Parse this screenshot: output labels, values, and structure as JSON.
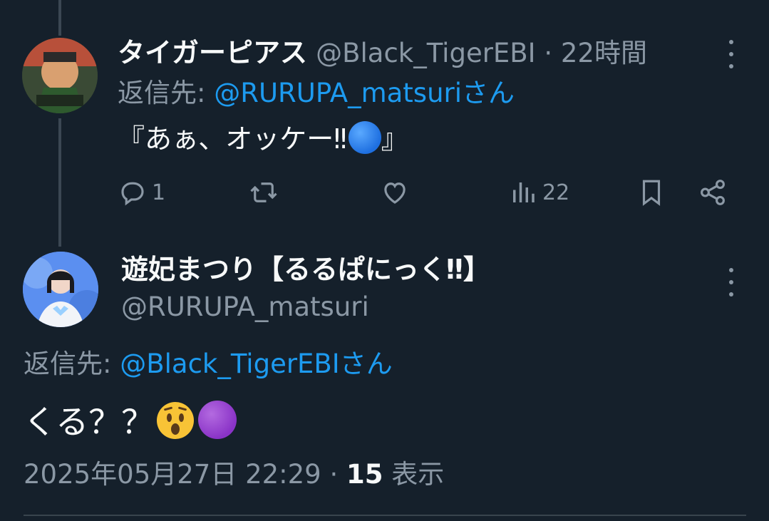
{
  "tweet1": {
    "display_name": "タイガーピアス",
    "handle": "@Black_TigerEBI",
    "separator": " · ",
    "time": "22時間",
    "reply_prefix": "返信先: ",
    "reply_mention": "@RURUPA_matsuri",
    "reply_suffix": "さん",
    "text_before": "『あぁ、オッケー‼",
    "text_after": "』",
    "actions": {
      "reply_count": "1",
      "views_count": "22"
    },
    "icons": [
      "reply-icon",
      "retweet-icon",
      "like-icon",
      "views-icon",
      "bookmark-icon",
      "share-icon",
      "more-icon"
    ]
  },
  "tweet2": {
    "display_name": "遊妃まつり【るるぱにっく‼】",
    "handle": "@RURUPA_matsuri",
    "reply_prefix": "返信先: ",
    "reply_mention": "@Black_TigerEBI",
    "reply_suffix": "さん",
    "text": "くる？？",
    "date": "2025年05月27日 22:29",
    "dot": " · ",
    "views_number": "15",
    "views_label": " 表示"
  },
  "colors": {
    "background": "#15202b",
    "text": "#f7f9f9",
    "muted": "#8b98a5",
    "accent": "#1d9bf0"
  }
}
